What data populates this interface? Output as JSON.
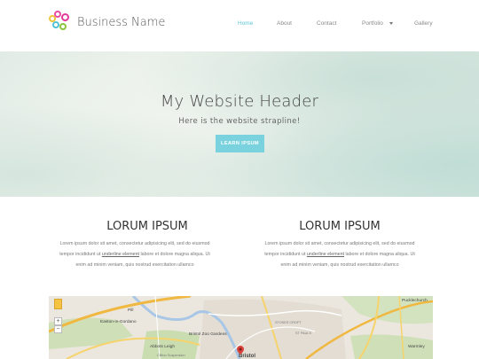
{
  "header": {
    "brand": "Business Name",
    "logo_icon": "colored-circles-logo",
    "nav": [
      {
        "label": "Home",
        "active": true
      },
      {
        "label": "About",
        "active": false
      },
      {
        "label": "Contact",
        "active": false
      },
      {
        "label": "Portfolio",
        "active": false,
        "has_dropdown": true
      },
      {
        "label": "Gallery",
        "active": false
      }
    ],
    "accent_color": "#5ec6d3"
  },
  "hero": {
    "title": "My Website Header",
    "subtitle": "Here is the website strapline!",
    "button_label": "LEARN IPSUM",
    "button_color": "#79d2dd"
  },
  "columns": [
    {
      "title": "LORUM IPSUM",
      "line1": "Lorem ipsum dolor sit amet, consectetur adipisicing elit, sed do eiusmod",
      "line2_before": "tempor incididunt ut ",
      "line2_link": "underline element",
      "line2_after": " labore et dolore magna aliqua. Ut",
      "line3": "enim ad minim veniam, quis nostrud exercitation ullamco"
    },
    {
      "title": "LORUM IPSUM",
      "line1": "Lorem ipsum dolor sit amet, consectetur adipisicing elit, sed do eiusmod",
      "line2_before": "tempor incididunt ut ",
      "line2_link": "underline element",
      "line2_after": " labore et dolore magna aliqua. Ut",
      "line3": "enim ad minim veniam, quis nostrud exercitation ullamco"
    }
  ],
  "map": {
    "zoom_in": "+",
    "zoom_out": "−",
    "labels": [
      "Pill",
      "Easton-in-Gordano",
      "Abbots Leigh",
      "Clifton Suspension",
      "Bristol Zoo Gardens",
      "STOKES CROFT",
      "ST PAULS",
      "Pucklechurch",
      "Warmley",
      "Bristol"
    ],
    "pin_icon": "map-pin-icon",
    "pegman_icon": "pegman-icon"
  }
}
